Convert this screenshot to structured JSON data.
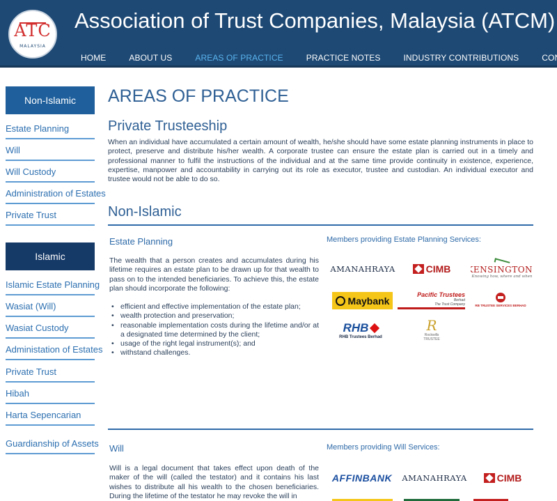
{
  "header": {
    "logo_letters": "ATC",
    "logo_sub": "MALAYSIA",
    "site_title": "Association of Trust Companies, Malaysia (ATCM)",
    "nav": [
      {
        "label": "HOME",
        "active": false
      },
      {
        "label": "ABOUT US",
        "active": false
      },
      {
        "label": "AREAS OF PRACTICE",
        "active": true
      },
      {
        "label": "PRACTICE NOTES",
        "active": false
      },
      {
        "label": "INDUSTRY CONTRIBUTIONS",
        "active": false
      },
      {
        "label": "CONTACT",
        "active": false
      }
    ]
  },
  "sidebar": {
    "non_islamic": {
      "heading": "Non-Islamic",
      "items": [
        "Estate Planning",
        "Will",
        "Will Custody",
        "Administration of Estates",
        "Private Trust"
      ]
    },
    "islamic": {
      "heading": "Islamic",
      "items": [
        "Islamic Estate Planning",
        "Wasiat (Will)",
        "Wasiat Custody",
        "Administation of Estates",
        "Private Trust",
        "Hibah",
        "Harta Sepencarian",
        "Guardianship of Assets"
      ]
    }
  },
  "main": {
    "page_title": "AREAS OF PRACTICE",
    "private_trusteeship": {
      "title": "Private Trusteeship",
      "text": "When an individual have accumulated a certain amount of wealth, he/she should have some estate planning instruments in place to protect, preserve and distribute his/her wealth. A corporate trustee can ensure the estate plan is carried out in a timely and professional manner to fulfil the instructions of the individual and at the same time provide continuity in existence, experience, expertise, manpower and accountability in carrying out its role as executor, trustee and custodian. An individual executor and trustee would not be able to do so."
    },
    "non_islamic": {
      "title": "Non-Islamic",
      "estate_planning": {
        "title": "Estate Planning",
        "text": "The wealth that a person creates and accumulates during his lifetime requires an estate plan to be drawn up for that wealth to pass on to the intended beneficiaries. To achieve this, the estate plan should incorporate the following:",
        "bullets": [
          "efficient and effective implementation of the estate plan;",
          "wealth protection and preservation;",
          "reasonable implementation costs during the lifetime and/or at a designated time determined by the client;",
          "usage of the right legal instrument(s); and",
          "withstand challenges."
        ],
        "members_title": "Members providing Estate Planning Services:",
        "logos": {
          "amanahraya": "AMANAHRAYA",
          "cimb": "CIMB",
          "kensington": "KENSINGTON",
          "kensington_reg": "®",
          "kensington_tag": "Knowing how, where and when",
          "maybank": "Maybank",
          "pacific": "Pacific Trustees",
          "pacific_sub": "Berhad",
          "pacific_small": "The Trust Company",
          "rb_trustee": "RB TRUSTEE SERVICES BERHAD",
          "rhb": "RHB",
          "rhb_sub": "RHB Trustees Berhad",
          "rockwills": "Rockwills",
          "rockwills_sub": "TRUSTEE"
        }
      },
      "will": {
        "title": "Will",
        "text": "Will is a legal document that takes effect upon death of the maker of the will (called the testator) and it contains his last wishes to distribute all his wealth to the chosen beneficiaries. During the lifetime of the testator he may revoke the will in",
        "members_title": "Members providing Will Services:",
        "logos": {
          "affin": "AFFINBANK",
          "amanahraya": "AMANAHRAYA",
          "cimb": "CIMB"
        }
      }
    }
  },
  "colors": {
    "header_bg": "#1e4974",
    "nav_active": "#5ab4ee",
    "sidebar_non_islamic": "#1e5f9c",
    "sidebar_islamic": "#163a68",
    "link": "#2c6fb0",
    "heading": "#2e5f94"
  }
}
